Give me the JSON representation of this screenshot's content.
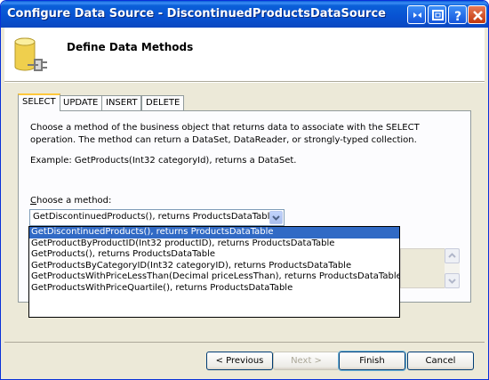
{
  "window": {
    "title": "Configure Data Source - DiscontinuedProductsDataSource"
  },
  "header": {
    "title": "Define Data Methods",
    "icon": "database-icon"
  },
  "tabs": [
    {
      "label": "SELECT",
      "active": true
    },
    {
      "label": "UPDATE",
      "active": false
    },
    {
      "label": "INSERT",
      "active": false
    },
    {
      "label": "DELETE",
      "active": false
    }
  ],
  "panel": {
    "description": "Choose a method of the business object that returns data to associate with the SELECT operation. The method can return a DataSet, DataReader, or strongly-typed collection.",
    "example": "Example: GetProducts(Int32 categoryId), returns a DataSet.",
    "choose_label_underlined": "C",
    "choose_label_rest": "hoose a method:"
  },
  "method_select": {
    "selected": "GetDiscontinuedProducts(), returns ProductsDataTable",
    "options": [
      "GetDiscontinuedProducts(), returns ProductsDataTable",
      "GetProductByProductID(Int32 productID), returns ProductsDataTable",
      "GetProducts(), returns ProductsDataTable",
      "GetProductsByCategoryID(Int32 categoryID), returns ProductsDataTable",
      "GetProductsWithPriceLessThan(Decimal priceLessThan), returns ProductsDataTable",
      "GetProductsWithPriceQuartile(), returns ProductsDataTable"
    ]
  },
  "buttons": {
    "previous": "< Previous",
    "next": "Next >",
    "finish": "Finish",
    "cancel": "Cancel"
  },
  "colors": {
    "title_bar": "#0a5fd8",
    "selection": "#316ac5",
    "dialog_bg": "#ece9d8"
  }
}
